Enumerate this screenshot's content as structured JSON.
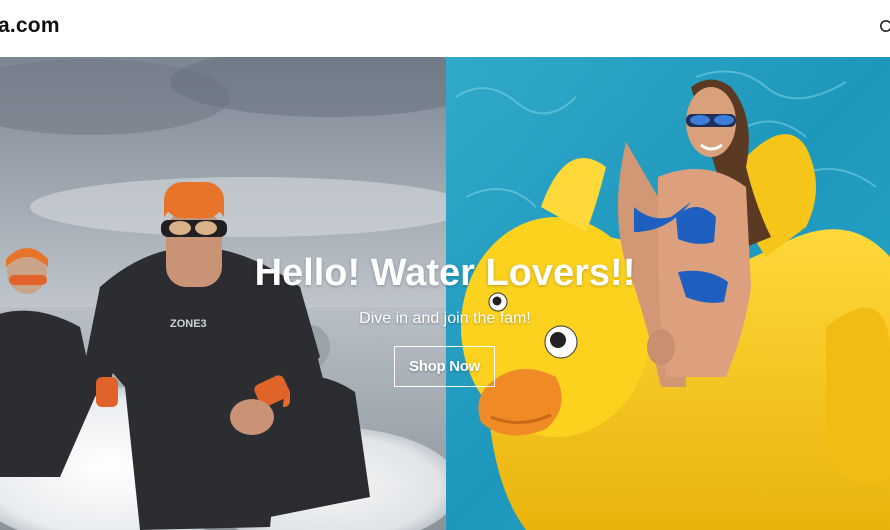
{
  "header": {
    "logo_text": "a.com",
    "search_icon": "search-icon"
  },
  "hero": {
    "title": "Hello! Water Lovers!!",
    "subtitle": "Dive in and join the fam!",
    "button_label": "Shop Now",
    "left_image": "swimmers-running-out-of-water-photo",
    "right_image": "woman-on-rubber-duck-float-photo"
  },
  "colors": {
    "header_bg": "#ffffff",
    "logo": "#111111",
    "hero_text": "#ffffff",
    "pool": "#2ea6c8",
    "duck_yellow": "#f5c518",
    "beak_orange": "#f08a24",
    "cap_orange": "#e8742a",
    "wetsuit": "#2b2d31",
    "swimsuit_blue": "#1f5fbf"
  }
}
